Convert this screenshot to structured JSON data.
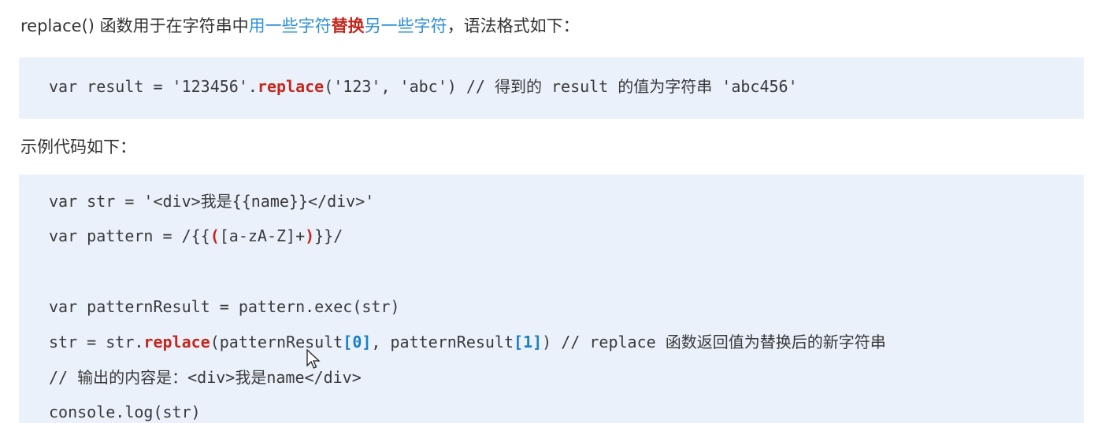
{
  "intro": {
    "part1": "replace() 函数用于在字符串中",
    "part2": "用一些字符",
    "part3": "替换",
    "part4": "另一些字符",
    "part5": "，语法格式如下："
  },
  "syntax": {
    "pre": "var result = '123456'.",
    "method": "replace",
    "post": "('123', 'abc') // 得到的 result 的值为字符串 'abc456'"
  },
  "example_label": "示例代码如下：",
  "code": {
    "line1": "var str = '<div>我是{{name}}</div>'",
    "line2_pre": "var pattern = /{{",
    "line2_open": "(",
    "line2_mid": "[a-zA-Z]+",
    "line2_close": ")",
    "line2_post": "}}/",
    "line3": "var patternResult = pattern.exec(str)",
    "line4_a": "str = str.",
    "line4_method": "replace",
    "line4_b": "(patternResult",
    "line4_idx0": "[0]",
    "line4_c": ", patternResult",
    "line4_idx1": "[1]",
    "line4_d": ") // replace 函数返回值为替换后的新字符串",
    "line5": "// 输出的内容是：<div>我是name</div>",
    "line6": "console.log(str)"
  }
}
